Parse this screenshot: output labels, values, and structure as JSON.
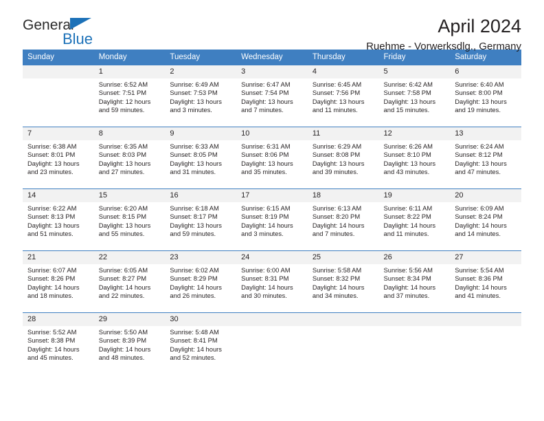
{
  "brand": {
    "name_top": "General",
    "name_bottom": "Blue",
    "flag_icon": "triangle-flag-icon",
    "accent_color": "#1c71b8"
  },
  "header": {
    "title": "April 2024",
    "subtitle": "Ruehme - Vorwerksdlg., Germany"
  },
  "theme": {
    "header_row_color": "#3f7fc1",
    "day_number_background": "#f2f2f2",
    "text_color": "#231f20"
  },
  "calendar": {
    "weekday_headers": [
      "Sunday",
      "Monday",
      "Tuesday",
      "Wednesday",
      "Thursday",
      "Friday",
      "Saturday"
    ],
    "weeks": [
      [
        {
          "day": "",
          "blank": true,
          "lines": []
        },
        {
          "day": "1",
          "lines": [
            "Sunrise: 6:52 AM",
            "Sunset: 7:51 PM",
            "Daylight: 12 hours",
            "and 59 minutes."
          ]
        },
        {
          "day": "2",
          "lines": [
            "Sunrise: 6:49 AM",
            "Sunset: 7:53 PM",
            "Daylight: 13 hours",
            "and 3 minutes."
          ]
        },
        {
          "day": "3",
          "lines": [
            "Sunrise: 6:47 AM",
            "Sunset: 7:54 PM",
            "Daylight: 13 hours",
            "and 7 minutes."
          ]
        },
        {
          "day": "4",
          "lines": [
            "Sunrise: 6:45 AM",
            "Sunset: 7:56 PM",
            "Daylight: 13 hours",
            "and 11 minutes."
          ]
        },
        {
          "day": "5",
          "lines": [
            "Sunrise: 6:42 AM",
            "Sunset: 7:58 PM",
            "Daylight: 13 hours",
            "and 15 minutes."
          ]
        },
        {
          "day": "6",
          "lines": [
            "Sunrise: 6:40 AM",
            "Sunset: 8:00 PM",
            "Daylight: 13 hours",
            "and 19 minutes."
          ]
        }
      ],
      [
        {
          "day": "7",
          "lines": [
            "Sunrise: 6:38 AM",
            "Sunset: 8:01 PM",
            "Daylight: 13 hours",
            "and 23 minutes."
          ]
        },
        {
          "day": "8",
          "lines": [
            "Sunrise: 6:35 AM",
            "Sunset: 8:03 PM",
            "Daylight: 13 hours",
            "and 27 minutes."
          ]
        },
        {
          "day": "9",
          "lines": [
            "Sunrise: 6:33 AM",
            "Sunset: 8:05 PM",
            "Daylight: 13 hours",
            "and 31 minutes."
          ]
        },
        {
          "day": "10",
          "lines": [
            "Sunrise: 6:31 AM",
            "Sunset: 8:06 PM",
            "Daylight: 13 hours",
            "and 35 minutes."
          ]
        },
        {
          "day": "11",
          "lines": [
            "Sunrise: 6:29 AM",
            "Sunset: 8:08 PM",
            "Daylight: 13 hours",
            "and 39 minutes."
          ]
        },
        {
          "day": "12",
          "lines": [
            "Sunrise: 6:26 AM",
            "Sunset: 8:10 PM",
            "Daylight: 13 hours",
            "and 43 minutes."
          ]
        },
        {
          "day": "13",
          "lines": [
            "Sunrise: 6:24 AM",
            "Sunset: 8:12 PM",
            "Daylight: 13 hours",
            "and 47 minutes."
          ]
        }
      ],
      [
        {
          "day": "14",
          "lines": [
            "Sunrise: 6:22 AM",
            "Sunset: 8:13 PM",
            "Daylight: 13 hours",
            "and 51 minutes."
          ]
        },
        {
          "day": "15",
          "lines": [
            "Sunrise: 6:20 AM",
            "Sunset: 8:15 PM",
            "Daylight: 13 hours",
            "and 55 minutes."
          ]
        },
        {
          "day": "16",
          "lines": [
            "Sunrise: 6:18 AM",
            "Sunset: 8:17 PM",
            "Daylight: 13 hours",
            "and 59 minutes."
          ]
        },
        {
          "day": "17",
          "lines": [
            "Sunrise: 6:15 AM",
            "Sunset: 8:19 PM",
            "Daylight: 14 hours",
            "and 3 minutes."
          ]
        },
        {
          "day": "18",
          "lines": [
            "Sunrise: 6:13 AM",
            "Sunset: 8:20 PM",
            "Daylight: 14 hours",
            "and 7 minutes."
          ]
        },
        {
          "day": "19",
          "lines": [
            "Sunrise: 6:11 AM",
            "Sunset: 8:22 PM",
            "Daylight: 14 hours",
            "and 11 minutes."
          ]
        },
        {
          "day": "20",
          "lines": [
            "Sunrise: 6:09 AM",
            "Sunset: 8:24 PM",
            "Daylight: 14 hours",
            "and 14 minutes."
          ]
        }
      ],
      [
        {
          "day": "21",
          "lines": [
            "Sunrise: 6:07 AM",
            "Sunset: 8:26 PM",
            "Daylight: 14 hours",
            "and 18 minutes."
          ]
        },
        {
          "day": "22",
          "lines": [
            "Sunrise: 6:05 AM",
            "Sunset: 8:27 PM",
            "Daylight: 14 hours",
            "and 22 minutes."
          ]
        },
        {
          "day": "23",
          "lines": [
            "Sunrise: 6:02 AM",
            "Sunset: 8:29 PM",
            "Daylight: 14 hours",
            "and 26 minutes."
          ]
        },
        {
          "day": "24",
          "lines": [
            "Sunrise: 6:00 AM",
            "Sunset: 8:31 PM",
            "Daylight: 14 hours",
            "and 30 minutes."
          ]
        },
        {
          "day": "25",
          "lines": [
            "Sunrise: 5:58 AM",
            "Sunset: 8:32 PM",
            "Daylight: 14 hours",
            "and 34 minutes."
          ]
        },
        {
          "day": "26",
          "lines": [
            "Sunrise: 5:56 AM",
            "Sunset: 8:34 PM",
            "Daylight: 14 hours",
            "and 37 minutes."
          ]
        },
        {
          "day": "27",
          "lines": [
            "Sunrise: 5:54 AM",
            "Sunset: 8:36 PM",
            "Daylight: 14 hours",
            "and 41 minutes."
          ]
        }
      ],
      [
        {
          "day": "28",
          "lines": [
            "Sunrise: 5:52 AM",
            "Sunset: 8:38 PM",
            "Daylight: 14 hours",
            "and 45 minutes."
          ]
        },
        {
          "day": "29",
          "lines": [
            "Sunrise: 5:50 AM",
            "Sunset: 8:39 PM",
            "Daylight: 14 hours",
            "and 48 minutes."
          ]
        },
        {
          "day": "30",
          "lines": [
            "Sunrise: 5:48 AM",
            "Sunset: 8:41 PM",
            "Daylight: 14 hours",
            "and 52 minutes."
          ]
        },
        {
          "day": "",
          "blank": true,
          "lines": []
        },
        {
          "day": "",
          "blank": true,
          "lines": []
        },
        {
          "day": "",
          "blank": true,
          "lines": []
        },
        {
          "day": "",
          "blank": true,
          "lines": []
        }
      ]
    ]
  }
}
